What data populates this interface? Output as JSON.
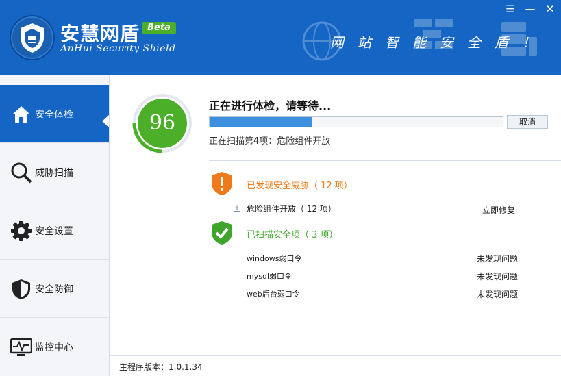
{
  "app": {
    "title": "安慧网盾",
    "badge": "Beta",
    "subtitle": "AnHui Security Shield",
    "slogan": "网站智能安全盾！"
  },
  "window_controls": {
    "menu": "☰",
    "minimize": "—",
    "close": "✕"
  },
  "sidebar": {
    "items": [
      {
        "label": "安全体检",
        "icon": "home-icon",
        "active": true
      },
      {
        "label": "威胁扫描",
        "icon": "magnifier-icon",
        "active": false
      },
      {
        "label": "安全设置",
        "icon": "gear-icon",
        "active": false
      },
      {
        "label": "安全防御",
        "icon": "shield-icon",
        "active": false
      },
      {
        "label": "监控中心",
        "icon": "monitor-icon",
        "active": false
      }
    ]
  },
  "scan": {
    "score": "96",
    "status": "正在进行体检，请等待...",
    "progress": 0.35,
    "cancel_label": "取消",
    "current_item": "正在扫描第4项：危险组件开放"
  },
  "threats": {
    "title": "已发现安全威胁（ 12 项）",
    "items": [
      {
        "label": "危险组件开放（ 12 项）",
        "action": "立即修复"
      }
    ]
  },
  "safe": {
    "title": "已扫描安全项（ 3 项）",
    "items": [
      {
        "label": "windows弱口令",
        "value": "未发现问题"
      },
      {
        "label": "mysql弱口令",
        "value": "未发现问题"
      },
      {
        "label": "web后台弱口令",
        "value": "未发现问题"
      }
    ]
  },
  "footer": {
    "version": "主程序版本：1.0.1.34"
  },
  "colors": {
    "brand_blue": "#1565c4",
    "score_green": "#4caf2a",
    "warning_orange": "#ee7a1b",
    "safe_green": "#3ea52a"
  }
}
